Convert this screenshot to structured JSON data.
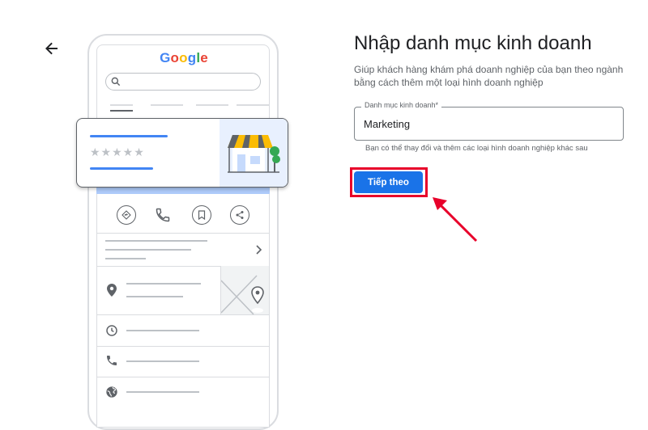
{
  "header": {
    "back_icon": "arrow-left-icon"
  },
  "illustration": {
    "logo_text": "Google",
    "logo_colors": [
      "#4285f4",
      "#ea4335",
      "#fbbc05",
      "#4285f4",
      "#34a853",
      "#ea4335"
    ],
    "rating_stars": "★★★★★",
    "icons": [
      "search-icon",
      "directions-icon",
      "phone-icon",
      "bookmark-icon",
      "share-icon",
      "chevron-right-icon",
      "location-pin-icon",
      "clock-icon",
      "phone-icon",
      "globe-icon",
      "storefront-icon"
    ]
  },
  "form": {
    "title": "Nhập danh mục kinh doanh",
    "subtitle": "Giúp khách hàng khám phá doanh nghiệp của bạn theo ngành bằng cách thêm một loại hình doanh nghiệp",
    "field_label": "Danh mục kinh doanh*",
    "field_value": "Marketing",
    "helper_text": "Bạn có thể thay đổi và thêm các loại hình doanh nghiệp khác sau",
    "next_button": "Tiếp theo"
  },
  "colors": {
    "primary": "#1a73e8",
    "highlight": "#e8002a",
    "annotation_arrow": "#e8002a"
  }
}
